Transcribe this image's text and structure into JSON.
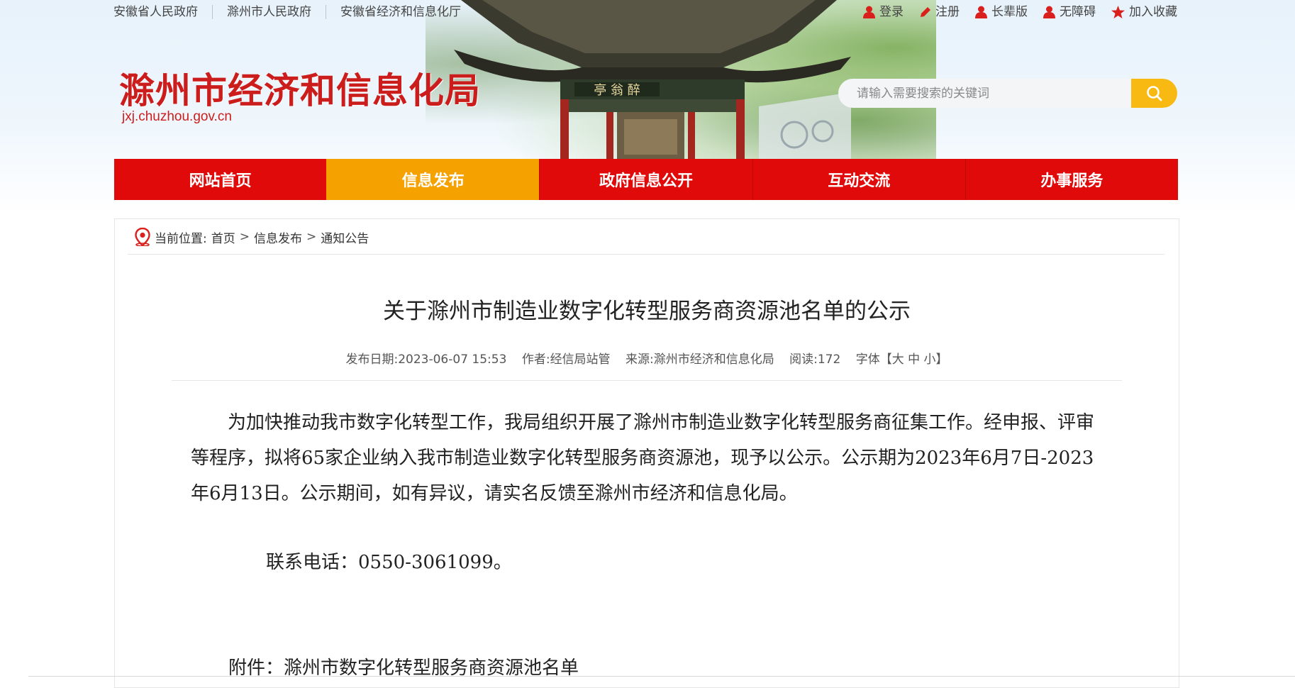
{
  "top_links": [
    "安徽省人民政府",
    "滁州市人民政府",
    "安徽省经济和信息化厅"
  ],
  "user_actions": [
    {
      "label": "登录",
      "icon": "user-icon"
    },
    {
      "label": "注册",
      "icon": "pencil-icon"
    },
    {
      "label": "长辈版",
      "icon": "user-icon"
    },
    {
      "label": "无障碍",
      "icon": "user-icon"
    },
    {
      "label": "加入收藏",
      "icon": "star-icon"
    }
  ],
  "site": {
    "title": "滁州市经济和信息化局",
    "domain": "jxj.chuzhou.gov.cn"
  },
  "search": {
    "placeholder": "请输入需要搜索的关键词"
  },
  "nav": [
    "网站首页",
    "信息发布",
    "政府信息公开",
    "互动交流",
    "办事服务"
  ],
  "nav_active": "信息发布",
  "breadcrumb": {
    "prefix": "当前位置:",
    "items": [
      "首页",
      "信息发布",
      "通知公告"
    ],
    "separator": ">"
  },
  "article": {
    "title": "关于滁州市制造业数字化转型服务商资源池名单的公示",
    "meta": {
      "date_label": "发布日期:",
      "date": "2023-06-07 15:53",
      "author_label": "作者:",
      "author": "经信局站管",
      "source_label": "来源:",
      "source": "滁州市经济和信息化局",
      "views_label": "阅读:",
      "views": "172",
      "font_label": "字体【",
      "font_large": "大",
      "font_medium": "中",
      "font_small": "小",
      "font_close": "】"
    },
    "body": "为加快推动我市数字化转型工作，我局组织开展了滁州市制造业数字化转型服务商征集工作。经申报、评审等程序，拟将65家企业纳入我市制造业数字化转型服务商资源池，现予以公示。公示期为2023年6月7日-2023年6月13日。公示期间，如有异议，请实名反馈至滁州市经济和信息化局。",
    "contact": "联系电话：0550-3061099。",
    "attachment": "附件：滁州市数字化转型服务商资源池名单"
  },
  "colors": {
    "nav_red": "#e10a0a",
    "nav_active": "#f5a100",
    "title_red": "#cc1d1d",
    "search_button": "#f8b912"
  }
}
